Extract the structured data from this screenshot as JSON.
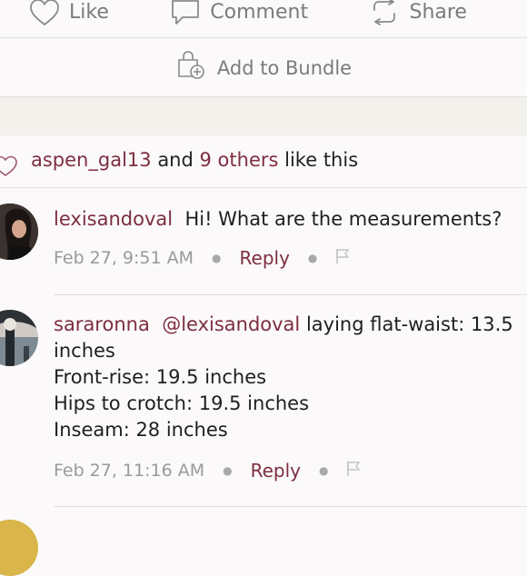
{
  "actions": {
    "like": "Like",
    "comment": "Comment",
    "share": "Share"
  },
  "bundle": {
    "label": "Add to Bundle"
  },
  "likes": {
    "user": "aspen_gal13",
    "and": "and",
    "others": "9 others",
    "suffix": "like this"
  },
  "comments": [
    {
      "username": "lexisandoval",
      "mention": "",
      "lines": [
        "Hi! What are the measurements?"
      ],
      "timestamp": "Feb 27, 9:51 AM",
      "reply": "Reply"
    },
    {
      "username": "sararonna",
      "mention": "@lexisandoval",
      "lines": [
        "laying flat-waist: 13.5",
        "inches",
        "Front-rise: 19.5 inches",
        "Hips to crotch: 19.5 inches",
        "Inseam: 28 inches"
      ],
      "timestamp": "Feb 27, 11:16 AM",
      "reply": "Reply"
    }
  ],
  "icons": {
    "like": "heart-outline-icon",
    "comment": "speech-bubble-icon",
    "share": "share-arrows-icon",
    "bundle": "bag-plus-icon",
    "flag": "flag-icon"
  },
  "colors": {
    "accent": "#7d2e41",
    "muted": "#7b7b7b",
    "divider": "#e2dfe0"
  }
}
